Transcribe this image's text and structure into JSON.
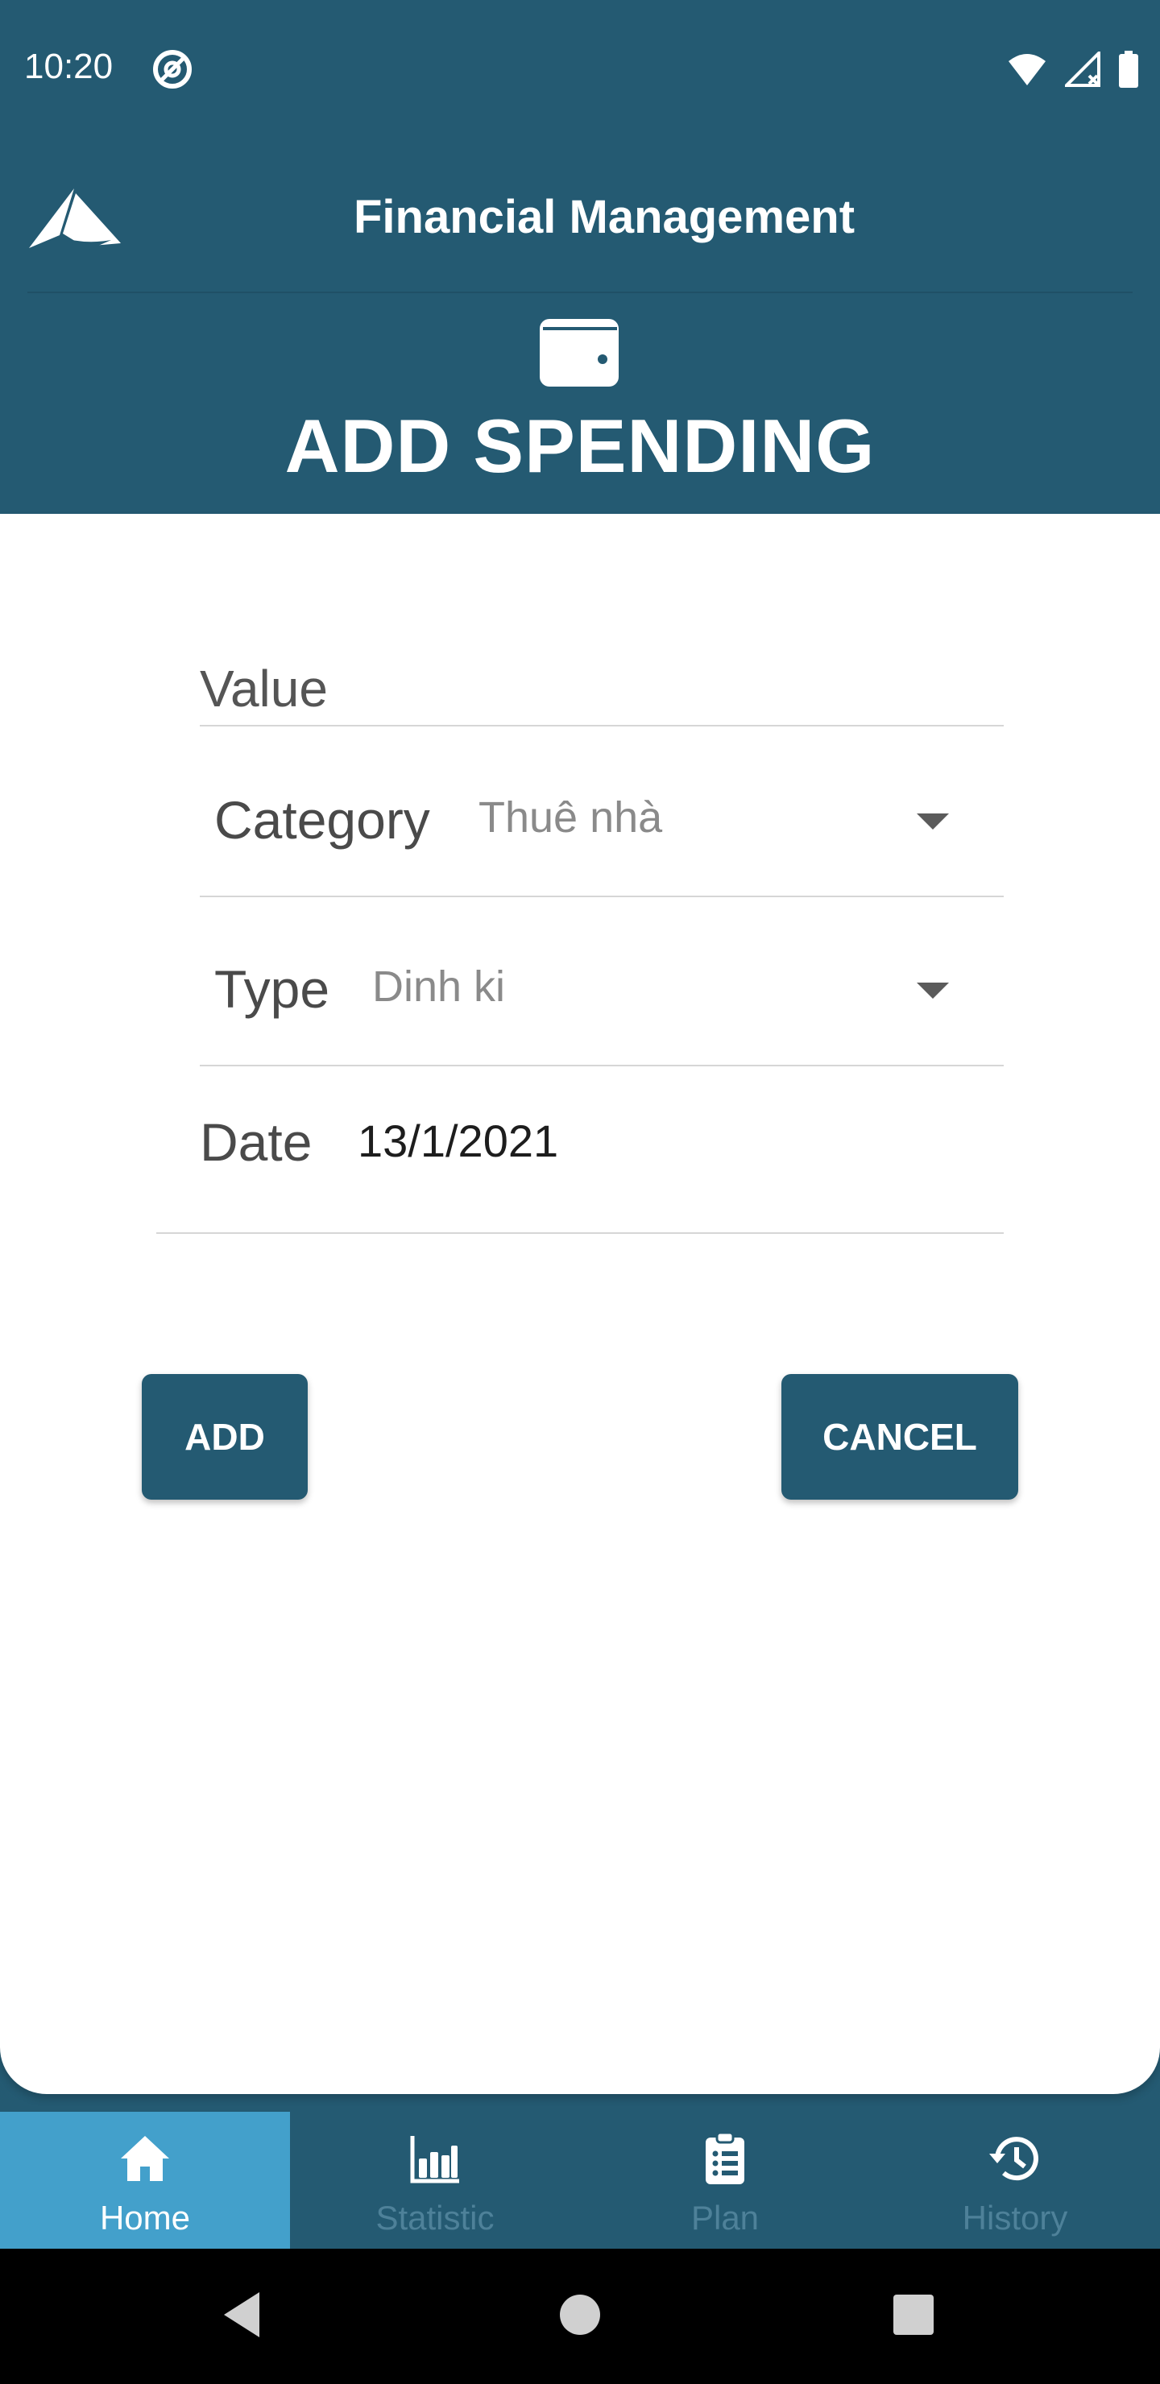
{
  "status_bar": {
    "time": "10:20"
  },
  "header": {
    "app_title": "Financial Management",
    "page_title": "ADD SPENDING"
  },
  "form": {
    "value_placeholder": "Value",
    "category": {
      "label": "Category",
      "selected": "Thuê nhà"
    },
    "type": {
      "label": "Type",
      "selected": "Dinh ki"
    },
    "date": {
      "label": "Date",
      "value": "13/1/2021"
    }
  },
  "buttons": {
    "add": "ADD",
    "cancel": "CANCEL"
  },
  "bottom_nav": {
    "items": [
      {
        "label": "Home",
        "icon": "home-icon",
        "active": true
      },
      {
        "label": "Statistic",
        "icon": "bar-chart-icon",
        "active": false
      },
      {
        "label": "Plan",
        "icon": "clipboard-list-icon",
        "active": false
      },
      {
        "label": "History",
        "icon": "history-icon",
        "active": false
      }
    ]
  },
  "colors": {
    "primary": "#245a72",
    "active_tab": "#43a0cb",
    "inactive_tab_text": "#4e8199"
  }
}
